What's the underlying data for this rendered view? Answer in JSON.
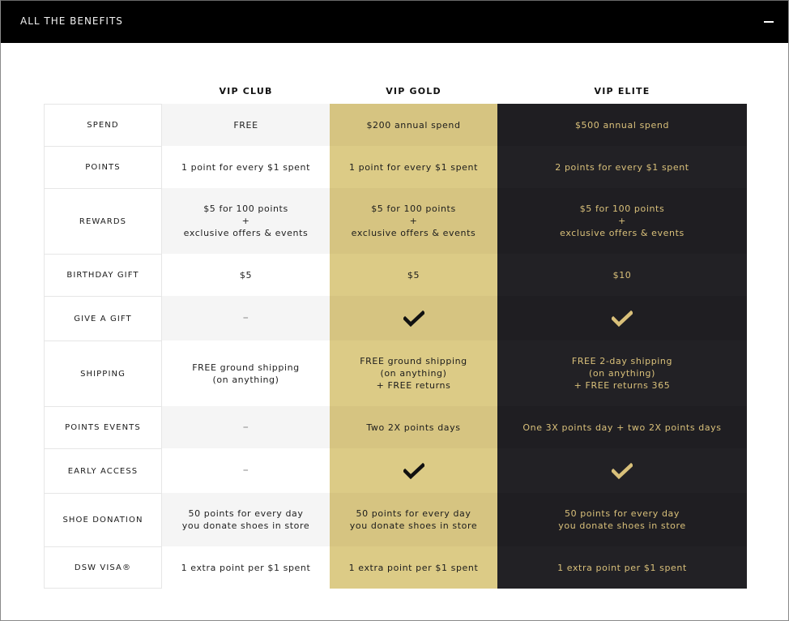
{
  "header": {
    "title": "ALL THE BENEFITS",
    "collapse_icon": "minus-icon"
  },
  "columns": [
    "VIP CLUB",
    "VIP GOLD",
    "VIP ELITE"
  ],
  "colors": {
    "gold_column": "#d6c481",
    "elite_column": "#1f1e22",
    "elite_text": "#d9c07a",
    "club_column_alt": "#f5f5f5"
  },
  "rows": [
    {
      "label": "SPEND",
      "club": "FREE",
      "gold": "$200 annual spend",
      "elite": "$500 annual spend"
    },
    {
      "label": "POINTS",
      "club": "1 point for every $1 spent",
      "gold": "1 point for every $1 spent",
      "elite": "2 points for every $1 spent"
    },
    {
      "label": "REWARDS",
      "club": "$5 for 100 points\n+\nexclusive offers & events",
      "gold": "$5 for 100 points\n+\nexclusive offers & events",
      "elite": "$5 for 100 points\n+\nexclusive offers & events"
    },
    {
      "label": "BIRTHDAY GIFT",
      "club": "$5",
      "gold": "$5",
      "elite": "$10"
    },
    {
      "label": "GIVE A GIFT",
      "club": "–",
      "gold": "check-icon",
      "elite": "check-icon"
    },
    {
      "label": "SHIPPING",
      "club": "FREE ground shipping\n(on anything)",
      "gold": "FREE ground shipping\n(on anything)\n+ FREE returns",
      "elite": "FREE 2-day shipping\n(on anything)\n+ FREE returns 365"
    },
    {
      "label": "POINTS EVENTS",
      "club": "–",
      "gold": "Two 2X points days",
      "elite": "One 3X points day + two 2X points days"
    },
    {
      "label": "EARLY ACCESS",
      "club": "–",
      "gold": "check-icon",
      "elite": "check-icon"
    },
    {
      "label": "SHOE DONATION",
      "club": "50 points for every day\nyou donate shoes in store",
      "gold": "50 points for every day\nyou donate shoes in store",
      "elite": "50 points for every day\nyou donate shoes in store"
    },
    {
      "label": "DSW VISA®",
      "club": "1 extra point per $1 spent",
      "gold": "1 extra point per $1 spent",
      "elite": "1 extra point per $1 spent"
    }
  ]
}
